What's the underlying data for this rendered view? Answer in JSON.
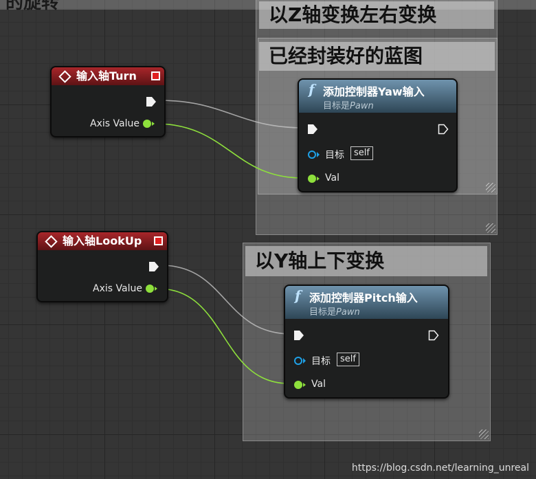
{
  "top_comment_text": "的旋转",
  "comments": {
    "yaw_title": "以Z轴变换左右变换",
    "blueprint_title": "已经封装好的蓝图",
    "pitch_title": "以Y轴上下变换"
  },
  "turn_node": {
    "title": "输入轴Turn",
    "axis_label": "Axis Value"
  },
  "lookup_node": {
    "title": "输入轴LookUp",
    "axis_label": "Axis Value"
  },
  "yaw_node": {
    "title": "添加控制器Yaw输入",
    "subtitle_prefix": "目标是",
    "subtitle_target": "Pawn",
    "target_label": "目标",
    "self_label": "self",
    "val_label": "Val"
  },
  "pitch_node": {
    "title": "添加控制器Pitch输入",
    "subtitle_prefix": "目标是",
    "subtitle_target": "Pawn",
    "target_label": "目标",
    "self_label": "self",
    "val_label": "Val"
  },
  "icons": {
    "function": "f",
    "event": "diamond-icon",
    "exec": "exec-pin-icon",
    "stop": "stop-icon"
  },
  "colors": {
    "event_header": "#a8262a",
    "function_header": "#4e6f86",
    "float_pin": "#8ee03c",
    "object_pin": "#1ea0e6"
  },
  "watermark": "https://blog.csdn.net/learning_unreal"
}
